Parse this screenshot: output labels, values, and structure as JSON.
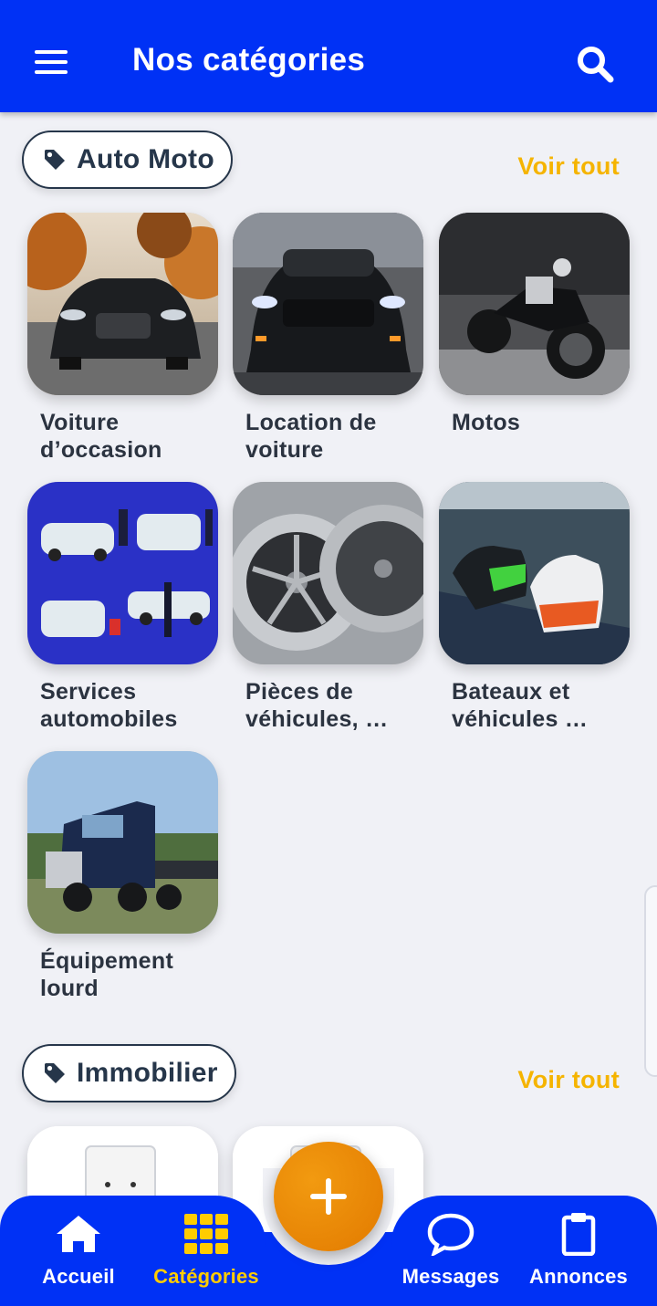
{
  "header": {
    "title": "Nos catégories",
    "menu_icon": "hamburger-menu-icon",
    "search_icon": "search-icon"
  },
  "sections": [
    {
      "title": "Auto Moto",
      "icon": "tag-icon",
      "see_all": "Voir tout",
      "items": [
        {
          "label": "Voiture d’occasion",
          "image": "black sports car on road"
        },
        {
          "label": "Location de voiture",
          "image": "black mustang front"
        },
        {
          "label": "Motos",
          "image": "black motorcycle"
        },
        {
          "label": "Services automobiles",
          "image": "car service illustration"
        },
        {
          "label": "Pièces de véhicules, …",
          "image": "alloy wheel rims"
        },
        {
          "label": "Bateaux et véhicules …",
          "image": "jet skis at dock"
        },
        {
          "label": "Équipement lourd",
          "image": "heavy truck"
        }
      ]
    },
    {
      "title": "Immobilier",
      "icon": "tag-icon",
      "see_all": "Voir tout",
      "items": [
        {
          "label": "",
          "image": "house icon"
        },
        {
          "label": "",
          "image": "building icon"
        }
      ]
    }
  ],
  "bottom_nav": {
    "items": [
      {
        "label": "Accueil",
        "icon": "home-icon",
        "active": false
      },
      {
        "label": "Catégories",
        "icon": "grid-icon",
        "active": true
      },
      {
        "label": "Messages",
        "icon": "chat-bubble-icon",
        "active": false
      },
      {
        "label": "Annonces",
        "icon": "clipboard-icon",
        "active": false
      }
    ],
    "fab_icon": "plus-icon"
  },
  "colors": {
    "primary": "#0031f5",
    "accent": "#f5b400",
    "fab": "#ec8c00",
    "active_nav": "#ffcc00",
    "background": "#f0f1f6"
  }
}
